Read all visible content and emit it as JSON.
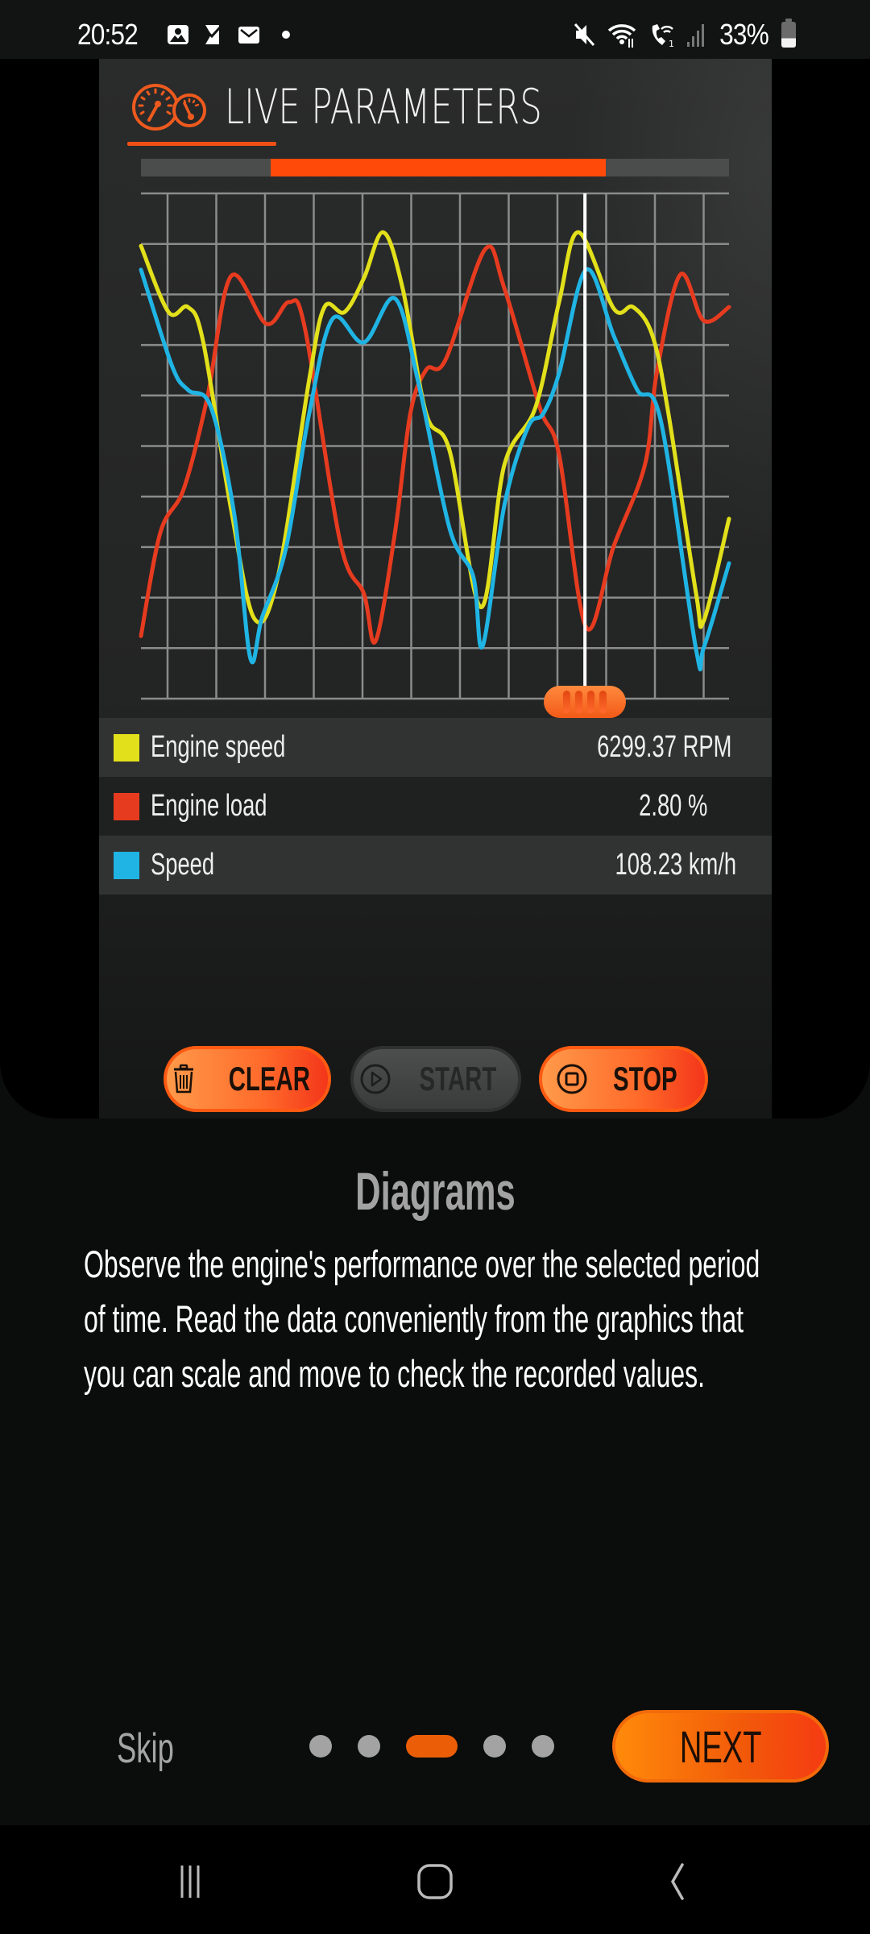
{
  "status_bar": {
    "time": "20:52",
    "notification_icons": [
      "gallery-icon",
      "task-check-icon",
      "email-icon",
      "dot-icon"
    ],
    "system_icons": [
      "mute-icon",
      "wifi-icon",
      "wifi-calling-icon",
      "signal-icon"
    ],
    "battery": "33%",
    "battery_level": 0.33
  },
  "card": {
    "title": "LIVE PARAMETERS",
    "range_selector": {
      "start": 0.22,
      "end": 0.79
    },
    "cursor_position": 0.755
  },
  "legend": [
    {
      "label": "Engine speed",
      "value": "6299.37 RPM",
      "color": "#e2e01a"
    },
    {
      "label": "Engine load",
      "value": "2.80 %",
      "color": "#e63b1f"
    },
    {
      "label": "Speed",
      "value": "108.23 km/h",
      "color": "#1fb4e3"
    }
  ],
  "controls": {
    "clear": "CLEAR",
    "start": "START",
    "stop": "STOP"
  },
  "onboarding": {
    "heading": "Diagrams",
    "description": "Observe the engine's performance over the selected period of time. Read the data conveniently from the graphics that you can scale and move to check the recorded values.",
    "skip": "Skip",
    "next": "NEXT",
    "pages": 5,
    "current_page": 3
  },
  "chart_data": {
    "type": "line",
    "title": "LIVE PARAMETERS",
    "xlabel": "",
    "ylabel": "",
    "x_range": [
      0,
      100
    ],
    "y_range": [
      0,
      100
    ],
    "grid": true,
    "grid_rows": 10,
    "grid_cols": 12,
    "legend_placement": "bottom",
    "cursor_x": 75.5,
    "series": [
      {
        "name": "Engine speed",
        "color": "#e2e01a",
        "x": [
          0,
          4.7,
          8,
          10.6,
          15.3,
          19.3,
          23.3,
          28.6,
          31.2,
          34.6,
          37.9,
          41.2,
          44.5,
          48.5,
          52.5,
          57.8,
          61.8,
          67.1,
          71.1,
          74.4,
          80.4,
          83.7,
          87,
          89.7,
          94.4,
          95.7,
          100
        ],
        "values": [
          89.6,
          76.5,
          77.5,
          70.5,
          37.6,
          15.8,
          24.2,
          63.1,
          77.5,
          76.5,
          83.2,
          92.3,
          81.2,
          56.4,
          49,
          18.1,
          46.3,
          57.7,
          78.5,
          92.3,
          77.2,
          77.5,
          71.8,
          56.4,
          20.8,
          15.4,
          35.6
        ]
      },
      {
        "name": "Engine load",
        "color": "#e63b1f",
        "x": [
          0,
          3.3,
          7.3,
          11.3,
          15.3,
          21.3,
          25.2,
          27.9,
          33.9,
          37.9,
          39.9,
          43.2,
          45.8,
          48.5,
          51.8,
          58.5,
          61.8,
          67.8,
          71.1,
          75.7,
          80.4,
          85.7,
          87.7,
          91.7,
          95.7,
          100
        ],
        "values": [
          12.4,
          32.9,
          41.6,
          59.7,
          83.6,
          74.2,
          78.5,
          73.2,
          30.9,
          20.8,
          11.4,
          32.9,
          56.4,
          65.1,
          67.1,
          88.9,
          81.2,
          57.7,
          48.3,
          14.1,
          30.2,
          46.3,
          64.4,
          83.9,
          74.8,
          77.5
        ]
      },
      {
        "name": "Speed",
        "color": "#1fb4e3",
        "x": [
          0,
          5.3,
          8,
          11.9,
          15.9,
          18.6,
          20.6,
          24.6,
          28.6,
          32.6,
          37.9,
          43.2,
          47.2,
          52.5,
          56.5,
          58.1,
          61.8,
          65.8,
          68.4,
          71.1,
          75.7,
          80.4,
          84.4,
          88.4,
          94.4,
          95.7,
          100
        ],
        "values": [
          84.9,
          65.8,
          61.1,
          57.7,
          36.2,
          8,
          16.1,
          29.5,
          56.4,
          75.2,
          70.5,
          79.2,
          62.4,
          33.6,
          24.2,
          10.4,
          38.3,
          53.7,
          56.4,
          64.4,
          84.9,
          71.8,
          61.1,
          55,
          9.7,
          10.1,
          26.8
        ]
      }
    ]
  }
}
